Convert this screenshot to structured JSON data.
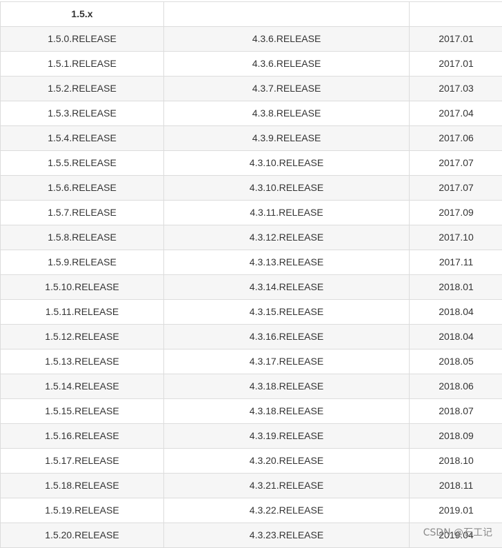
{
  "table": {
    "header": [
      "1.5.x",
      "",
      ""
    ],
    "rows": [
      [
        "1.5.0.RELEASE",
        "4.3.6.RELEASE",
        "2017.01"
      ],
      [
        "1.5.1.RELEASE",
        "4.3.6.RELEASE",
        "2017.01"
      ],
      [
        "1.5.2.RELEASE",
        "4.3.7.RELEASE",
        "2017.03"
      ],
      [
        "1.5.3.RELEASE",
        "4.3.8.RELEASE",
        "2017.04"
      ],
      [
        "1.5.4.RELEASE",
        "4.3.9.RELEASE",
        "2017.06"
      ],
      [
        "1.5.5.RELEASE",
        "4.3.10.RELEASE",
        "2017.07"
      ],
      [
        "1.5.6.RELEASE",
        "4.3.10.RELEASE",
        "2017.07"
      ],
      [
        "1.5.7.RELEASE",
        "4.3.11.RELEASE",
        "2017.09"
      ],
      [
        "1.5.8.RELEASE",
        "4.3.12.RELEASE",
        "2017.10"
      ],
      [
        "1.5.9.RELEASE",
        "4.3.13.RELEASE",
        "2017.11"
      ],
      [
        "1.5.10.RELEASE",
        "4.3.14.RELEASE",
        "2018.01"
      ],
      [
        "1.5.11.RELEASE",
        "4.3.15.RELEASE",
        "2018.04"
      ],
      [
        "1.5.12.RELEASE",
        "4.3.16.RELEASE",
        "2018.04"
      ],
      [
        "1.5.13.RELEASE",
        "4.3.17.RELEASE",
        "2018.05"
      ],
      [
        "1.5.14.RELEASE",
        "4.3.18.RELEASE",
        "2018.06"
      ],
      [
        "1.5.15.RELEASE",
        "4.3.18.RELEASE",
        "2018.07"
      ],
      [
        "1.5.16.RELEASE",
        "4.3.19.RELEASE",
        "2018.09"
      ],
      [
        "1.5.17.RELEASE",
        "4.3.20.RELEASE",
        "2018.10"
      ],
      [
        "1.5.18.RELEASE",
        "4.3.21.RELEASE",
        "2018.11"
      ],
      [
        "1.5.19.RELEASE",
        "4.3.22.RELEASE",
        "2019.01"
      ],
      [
        "1.5.20.RELEASE",
        "4.3.23.RELEASE",
        "2019.04"
      ]
    ]
  },
  "watermark": "CSDN @石工记",
  "colors": {
    "border": "#dcdcdc",
    "row_alt": "#f6f6f6",
    "text": "#333333"
  }
}
